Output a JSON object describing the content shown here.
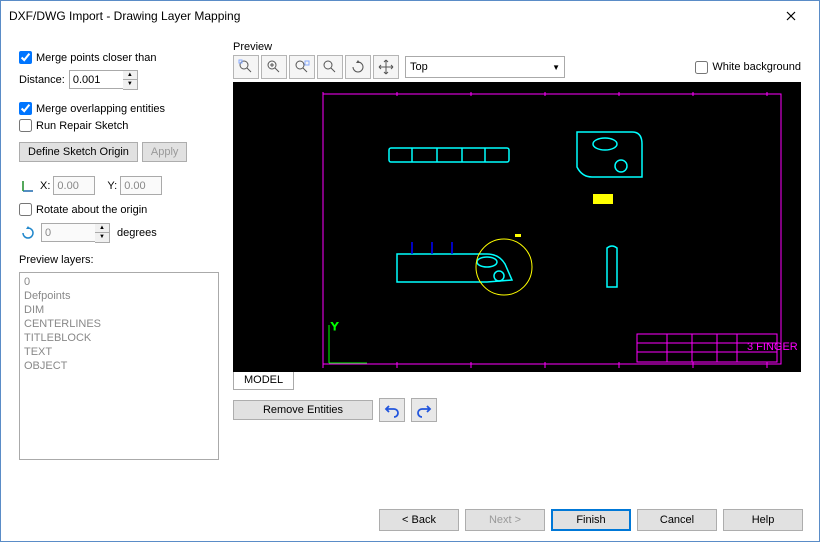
{
  "window": {
    "title": "DXF/DWG Import - Drawing Layer Mapping"
  },
  "left": {
    "merge_points_label": "Merge points closer than",
    "merge_points_checked": true,
    "distance_label": "Distance:",
    "distance_value": "0.001",
    "merge_overlap_label": "Merge overlapping entities",
    "merge_overlap_checked": true,
    "run_repair_label": "Run Repair Sketch",
    "run_repair_checked": false,
    "define_origin_btn": "Define Sketch Origin",
    "apply_btn": "Apply",
    "x_label": "X:",
    "x_value": "0.00",
    "y_label": "Y:",
    "y_value": "0.00",
    "rotate_label": "Rotate about the origin",
    "rotate_checked": false,
    "angle_value": "0",
    "degrees_label": "degrees",
    "preview_layers_label": "Preview layers:",
    "layers": [
      "0",
      "Defpoints",
      "DIM",
      "CENTERLINES",
      "TITLEBLOCK",
      "TEXT",
      "OBJECT"
    ]
  },
  "preview": {
    "label": "Preview",
    "view_sel": "Top",
    "white_bg_label": "White background",
    "white_bg_checked": false,
    "tab": "MODEL",
    "remove_btn": "Remove Entities"
  },
  "footer": {
    "back": "< Back",
    "next": "Next >",
    "finish": "Finish",
    "cancel": "Cancel",
    "help": "Help"
  }
}
